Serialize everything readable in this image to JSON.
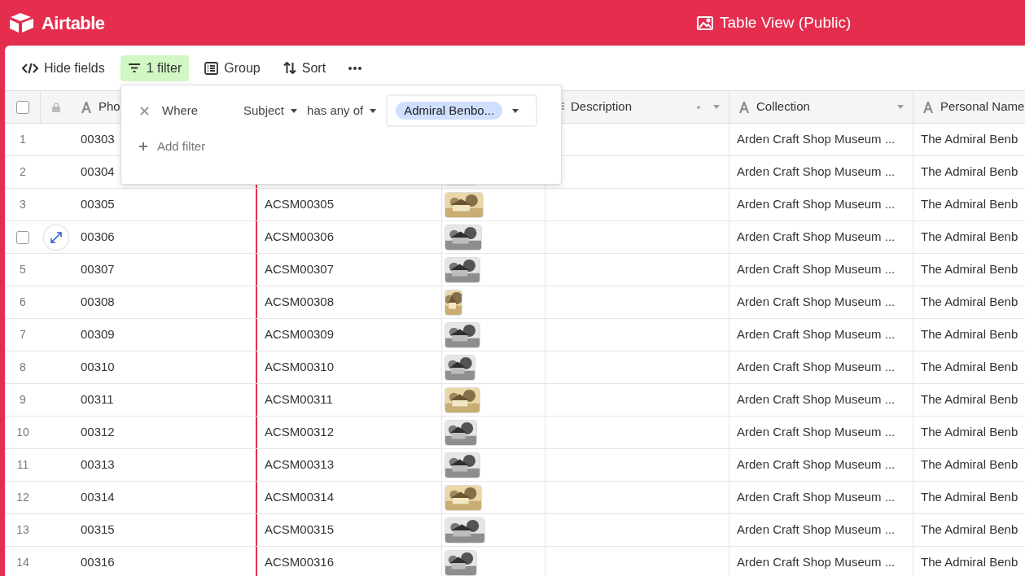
{
  "app": {
    "name": "Airtable"
  },
  "view": {
    "title": "Table View (Public)"
  },
  "toolbar": [
    {
      "kind": "hide",
      "label": "Hide fields",
      "active": false
    },
    {
      "kind": "filter",
      "label": "1 filter",
      "active": true
    },
    {
      "kind": "group",
      "label": "Group",
      "active": false
    },
    {
      "kind": "sort",
      "label": "Sort",
      "active": false
    },
    {
      "kind": "more",
      "active": false
    }
  ],
  "filter_popup": {
    "conditions": [
      {
        "prefix": "Where",
        "field": "Subject",
        "operator": "has any of",
        "value": "Admiral Benbo..."
      }
    ],
    "add_label": "Add filter"
  },
  "table": {
    "all_selected": false,
    "columns": [
      {
        "kind": "text",
        "label": "Pho"
      },
      {
        "kind": "hidden"
      },
      {
        "kind": "hidden"
      },
      {
        "kind": "longtext",
        "label": "Description"
      },
      {
        "kind": "text",
        "label": "Collection"
      },
      {
        "kind": "text",
        "label": "Personal Name"
      }
    ],
    "rows": [
      {
        "number": "1",
        "hovered": false,
        "id": "00303",
        "collection": "Arden Craft Shop Museum ...",
        "personal_name": "The Admiral Benb"
      },
      {
        "number": "2",
        "hovered": false,
        "id": "00304",
        "attachment": true,
        "collection": "Arden Craft Shop Museum ...",
        "personal_name": "The Admiral Benb"
      },
      {
        "number": "3",
        "hovered": false,
        "id": "00305",
        "code": "ACSM00305",
        "attachment": true,
        "collection": "Arden Craft Shop Museum ...",
        "personal_name": "The Admiral Benb"
      },
      {
        "hovered": true,
        "checked": false,
        "id": "00306",
        "code": "ACSM00306",
        "attachment": true,
        "collection": "Arden Craft Shop Museum ...",
        "personal_name": "The Admiral Benb"
      },
      {
        "number": "5",
        "hovered": false,
        "id": "00307",
        "code": "ACSM00307",
        "attachment": true,
        "collection": "Arden Craft Shop Museum ...",
        "personal_name": "The Admiral Benb"
      },
      {
        "number": "6",
        "hovered": false,
        "id": "00308",
        "code": "ACSM00308",
        "attachment": true,
        "collection": "Arden Craft Shop Museum ...",
        "personal_name": "The Admiral Benb"
      },
      {
        "number": "7",
        "hovered": false,
        "id": "00309",
        "code": "ACSM00309",
        "attachment": true,
        "collection": "Arden Craft Shop Museum ...",
        "personal_name": "The Admiral Benb"
      },
      {
        "number": "8",
        "hovered": false,
        "id": "00310",
        "code": "ACSM00310",
        "attachment": true,
        "collection": "Arden Craft Shop Museum ...",
        "personal_name": "The Admiral Benb"
      },
      {
        "number": "9",
        "hovered": false,
        "id": "00311",
        "code": "ACSM00311",
        "attachment": true,
        "collection": "Arden Craft Shop Museum ...",
        "personal_name": "The Admiral Benb"
      },
      {
        "number": "10",
        "hovered": false,
        "id": "00312",
        "code": "ACSM00312",
        "attachment": true,
        "collection": "Arden Craft Shop Museum ...",
        "personal_name": "The Admiral Benb"
      },
      {
        "number": "11",
        "hovered": false,
        "id": "00313",
        "code": "ACSM00313",
        "attachment": true,
        "collection": "Arden Craft Shop Museum ...",
        "personal_name": "The Admiral Benb"
      },
      {
        "number": "12",
        "hovered": false,
        "id": "00314",
        "code": "ACSM00314",
        "attachment": true,
        "collection": "Arden Craft Shop Museum ...",
        "personal_name": "The Admiral Benb"
      },
      {
        "number": "13",
        "hovered": false,
        "id": "00315",
        "code": "ACSM00315",
        "attachment": true,
        "collection": "Arden Craft Shop Museum ...",
        "personal_name": "The Admiral Benb"
      },
      {
        "number": "14",
        "hovered": false,
        "id": "00316",
        "code": "ACSM00316",
        "attachment": true,
        "collection": "Arden Craft Shop Museum ...",
        "personal_name": "The Admiral Benb"
      }
    ]
  }
}
